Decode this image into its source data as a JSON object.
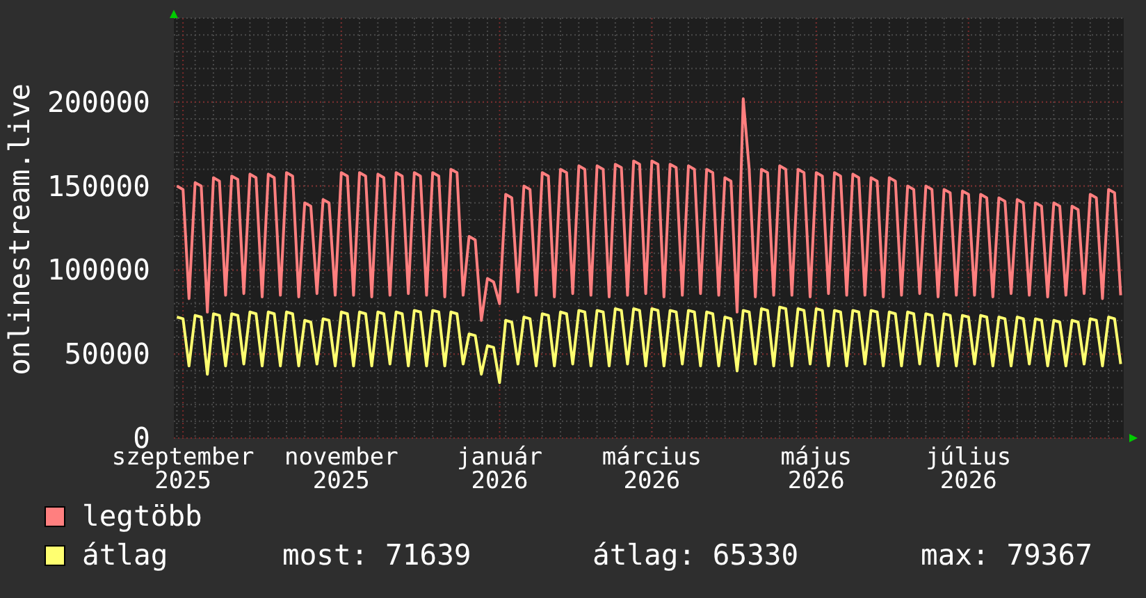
{
  "chart": {
    "chart_data": {
      "type": "line",
      "grid": true,
      "ylabel": "onlinestream.live",
      "ylim": [
        0,
        250000
      ],
      "yticks": [
        0,
        50000,
        100000,
        150000,
        200000
      ],
      "categories": [
        null,
        "szeptember 2025",
        null,
        null,
        null,
        null,
        null,
        null,
        null,
        null,
        null,
        null,
        null,
        null,
        null,
        null,
        null,
        null,
        null,
        null,
        null,
        null,
        null,
        null,
        null,
        null,
        null,
        "november 2025",
        null,
        null,
        null,
        null,
        null,
        null,
        null,
        null,
        null,
        null,
        null,
        null,
        null,
        null,
        null,
        null,
        null,
        null,
        null,
        null,
        null,
        null,
        null,
        null,
        null,
        "január 2026",
        null,
        null,
        null,
        null,
        null,
        null,
        null,
        null,
        null,
        null,
        null,
        null,
        null,
        null,
        null,
        null,
        null,
        null,
        null,
        null,
        null,
        null,
        null,
        null,
        "március 2026",
        null,
        null,
        null,
        null,
        null,
        null,
        null,
        null,
        null,
        null,
        null,
        null,
        null,
        null,
        null,
        null,
        null,
        null,
        null,
        null,
        null,
        null,
        null,
        null,
        null,
        null,
        "május 2026",
        null,
        null,
        null,
        null,
        null,
        null,
        null,
        null,
        null,
        null,
        null,
        null,
        null,
        null,
        null,
        null,
        null,
        null,
        null,
        null,
        null,
        null,
        null,
        null,
        "július 2026",
        null,
        null,
        null,
        null,
        null,
        null,
        null,
        null,
        null,
        null,
        null,
        null,
        null,
        null,
        null,
        null,
        null,
        null,
        null,
        null,
        null,
        null,
        null,
        null,
        null
      ],
      "series": [
        {
          "name": "legtöbb",
          "color": "#ff7f7f",
          "values": [
            150000,
            148000,
            83000,
            152000,
            150000,
            75000,
            155000,
            153000,
            85000,
            156000,
            154000,
            86000,
            157000,
            155000,
            84000,
            157000,
            155000,
            85000,
            158000,
            156000,
            84000,
            140000,
            138000,
            86000,
            142000,
            140000,
            85000,
            158000,
            156000,
            85000,
            158000,
            156000,
            84000,
            157000,
            155000,
            85000,
            158000,
            156000,
            86000,
            158000,
            156000,
            85000,
            158000,
            156000,
            84000,
            160000,
            158000,
            85000,
            120000,
            118000,
            70000,
            95000,
            93000,
            80000,
            145000,
            143000,
            87000,
            150000,
            148000,
            85000,
            158000,
            156000,
            84000,
            160000,
            158000,
            86000,
            162000,
            160000,
            85000,
            162000,
            160000,
            84000,
            163000,
            161000,
            85000,
            165000,
            163000,
            86000,
            165000,
            163000,
            84000,
            163000,
            161000,
            85000,
            162000,
            160000,
            86000,
            160000,
            158000,
            85000,
            155000,
            153000,
            75000,
            202000,
            160000,
            84000,
            160000,
            158000,
            85000,
            162000,
            160000,
            85000,
            160000,
            158000,
            84000,
            158000,
            156000,
            86000,
            158000,
            156000,
            85000,
            157000,
            155000,
            85000,
            155000,
            153000,
            84000,
            155000,
            153000,
            85000,
            150000,
            148000,
            86000,
            150000,
            148000,
            84000,
            148000,
            146000,
            85000,
            147000,
            145000,
            85000,
            145000,
            143000,
            84000,
            143000,
            141000,
            86000,
            142000,
            140000,
            85000,
            140000,
            138000,
            84000,
            140000,
            138000,
            85000,
            138000,
            136000,
            86000,
            145000,
            143000,
            83000,
            148000,
            146000,
            85000
          ]
        },
        {
          "name": "átlag",
          "color": "#ffff70",
          "values": [
            72000,
            71000,
            43000,
            73000,
            72000,
            38000,
            74000,
            73000,
            43000,
            74000,
            73000,
            44000,
            75000,
            74000,
            43000,
            75000,
            74000,
            43000,
            75000,
            74000,
            43000,
            70000,
            69000,
            44000,
            71000,
            70000,
            43000,
            75000,
            74000,
            43000,
            75000,
            74000,
            43000,
            75000,
            74000,
            44000,
            75000,
            74000,
            43000,
            76000,
            75000,
            43000,
            76000,
            75000,
            43000,
            75000,
            74000,
            44000,
            62000,
            61000,
            38000,
            55000,
            54000,
            33000,
            70000,
            69000,
            44000,
            72000,
            71000,
            43000,
            74000,
            73000,
            43000,
            75000,
            74000,
            44000,
            76000,
            75000,
            43000,
            76000,
            75000,
            43000,
            77000,
            76000,
            44000,
            77000,
            76000,
            43000,
            77000,
            76000,
            43000,
            76000,
            75000,
            44000,
            76000,
            75000,
            43000,
            75000,
            74000,
            43000,
            72000,
            71000,
            40000,
            76000,
            75000,
            44000,
            77000,
            76000,
            43000,
            78000,
            77000,
            43000,
            77000,
            76000,
            44000,
            77000,
            76000,
            43000,
            76000,
            75000,
            43000,
            76000,
            75000,
            44000,
            76000,
            75000,
            43000,
            75000,
            74000,
            43000,
            75000,
            74000,
            44000,
            74000,
            73000,
            43000,
            74000,
            73000,
            43000,
            73000,
            72000,
            44000,
            73000,
            72000,
            43000,
            72000,
            71000,
            43000,
            72000,
            71000,
            44000,
            71000,
            70000,
            43000,
            70000,
            69000,
            43000,
            70000,
            69000,
            44000,
            71000,
            70000,
            43000,
            72000,
            71000,
            44000
          ]
        }
      ]
    }
  },
  "legend": {
    "stats": [
      "most: 71639",
      "átlag: 65330",
      "max: 79367"
    ]
  }
}
